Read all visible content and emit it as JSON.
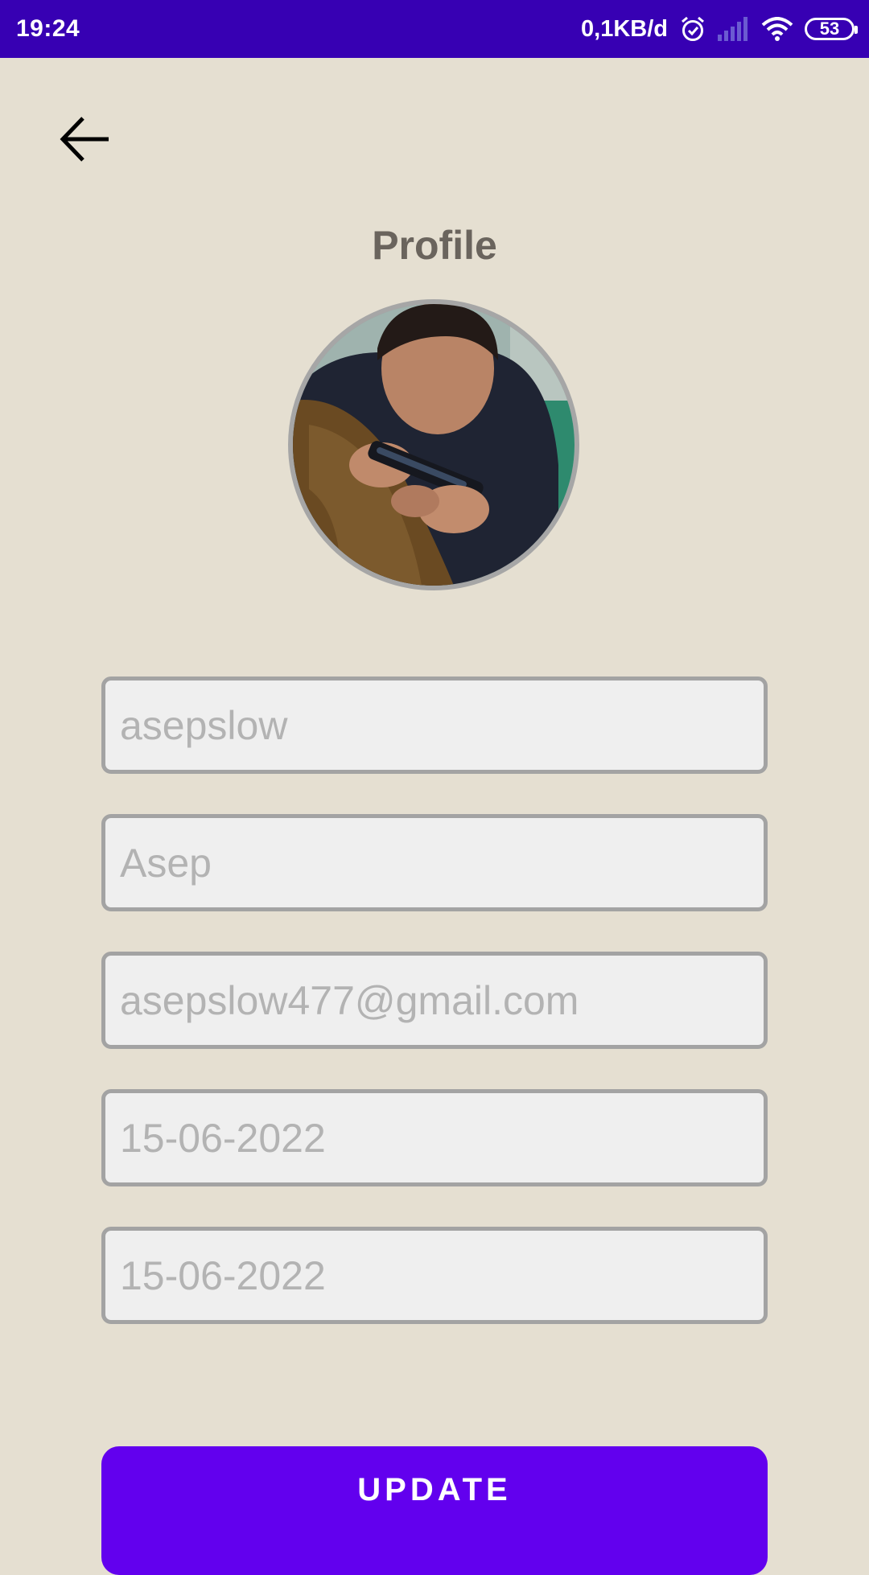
{
  "status_bar": {
    "time": "19:24",
    "network_speed": "0,1KB/d",
    "battery_level": "53",
    "icons": [
      "alarm-icon",
      "signal-icon",
      "wifi-icon",
      "battery-icon"
    ],
    "background_color": "#3700b3"
  },
  "header": {
    "back_icon": "arrow-left-icon",
    "title": "Profile"
  },
  "avatar": {
    "icon": "profile-photo"
  },
  "form": {
    "fields": [
      {
        "name": "username",
        "placeholder": "asepslow"
      },
      {
        "name": "name",
        "placeholder": "Asep"
      },
      {
        "name": "email",
        "placeholder": "asepslow477@gmail.com"
      },
      {
        "name": "date-1",
        "placeholder": "15-06-2022"
      },
      {
        "name": "date-2",
        "placeholder": "15-06-2022"
      }
    ]
  },
  "actions": {
    "update_label": "UPDATE",
    "accent_color": "#6200ee"
  },
  "colors": {
    "background": "#e5dfd1",
    "title": "#6a645d",
    "field_border": "#a3a3a3",
    "field_fill": "#efefef",
    "placeholder_text": "#b3b3b3"
  }
}
